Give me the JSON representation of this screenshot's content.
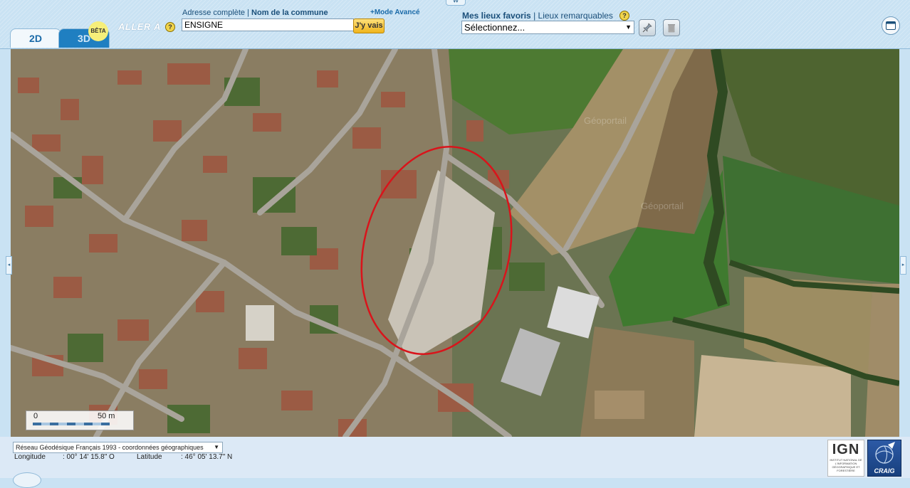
{
  "tabs": {
    "tab_2d": "2D",
    "tab_3d": "3D",
    "beta_badge": "BÊTA"
  },
  "goto": {
    "label": "ALLER À",
    "help": "?",
    "address_full_link": "Adresse complète",
    "separator": "|",
    "commune_link": "Nom de la commune",
    "advanced_mode_link": "+Mode Avancé",
    "search_value": "ENSIGNE",
    "go_button": "J'y vais"
  },
  "favorites": {
    "my_places_link": "Mes lieux favoris",
    "separator": "|",
    "remarkable_places_link": "Lieux remarquables",
    "help": "?",
    "select_value": "Sélectionnez..."
  },
  "map": {
    "scale_min": "0",
    "scale_max": "50 m",
    "watermark": "Géoportail"
  },
  "footer": {
    "crs_select": "Réseau Géodésique Français 1993 - coordonnées géographiques",
    "longitude_label": "Longitude",
    "longitude_value": ": 00° 14' 15.8\" O",
    "latitude_label": "Latitude",
    "latitude_value": ": 46° 05' 13.7\" N",
    "ign_logo": "IGN",
    "ign_subtitle": "INSTITUT NATIONAL DE L'INFORMATION GÉOGRAPHIQUE ET FORESTIÈRE",
    "craig_logo": "CRAIG"
  },
  "colors": {
    "toolbar_bg": "#c9e2f3",
    "accent_blue": "#1a6aa8",
    "annotation_red": "#d9141b",
    "go_button": "#f0b51c"
  },
  "icons": {
    "pin": "pushpin-icon",
    "trash": "trash-icon",
    "window": "window-icon",
    "help": "help-icon"
  }
}
